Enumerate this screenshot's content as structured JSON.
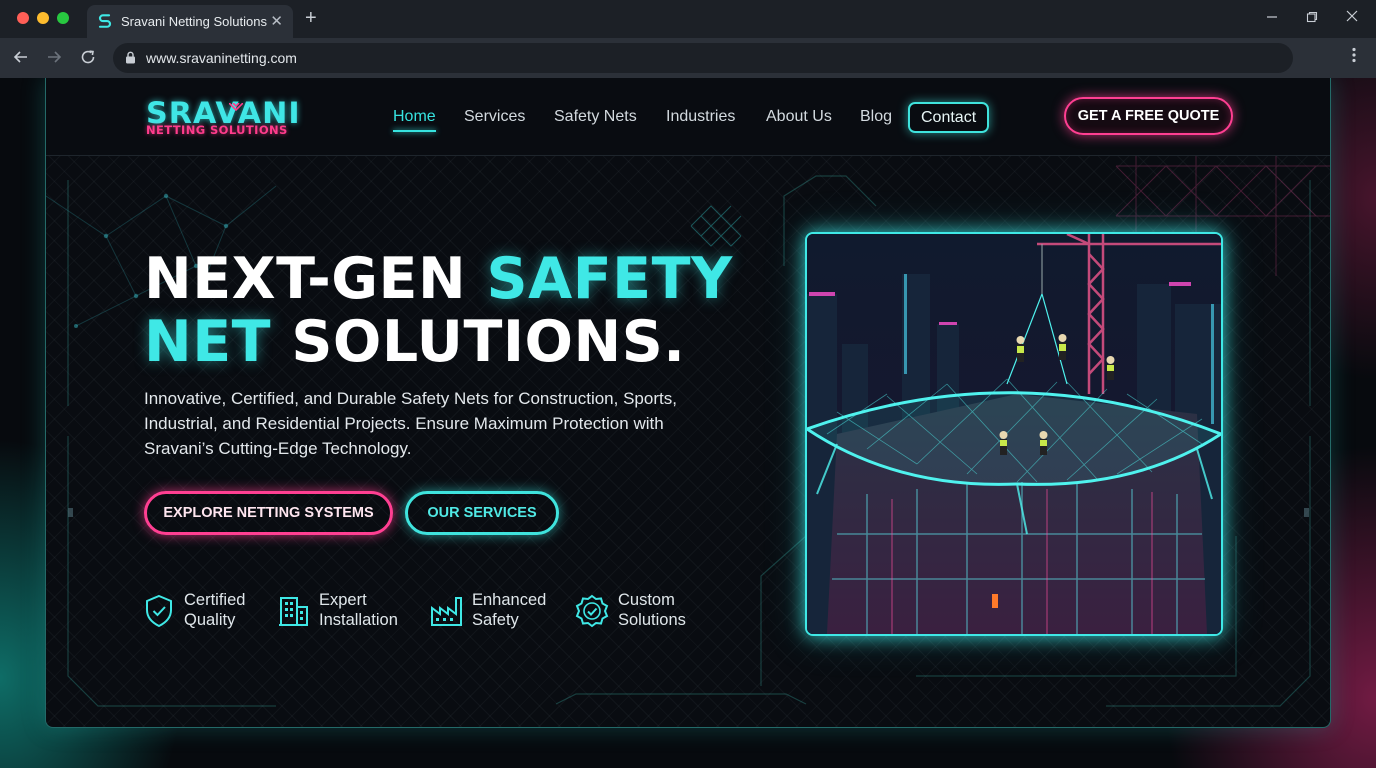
{
  "browser": {
    "tab_title": "Sravani Netting Solutions",
    "url": "www.sravaninetting.com",
    "icons": {
      "favicon": "s-logo-icon",
      "close_tab": "close-icon",
      "new_tab": "plus-icon",
      "back": "arrow-left-icon",
      "forward": "arrow-right-icon",
      "reload": "reload-icon",
      "lock": "lock-icon",
      "menu": "kebab-menu-icon",
      "minimize": "minimize-icon",
      "maximize": "restore-icon",
      "close_window": "close-icon"
    }
  },
  "site": {
    "logo": {
      "main": "SRAVANI",
      "sub": "NETTING SOLUTIONS"
    },
    "nav": {
      "items": [
        {
          "label": "Home",
          "active": true
        },
        {
          "label": "Services"
        },
        {
          "label": "Safety Nets"
        },
        {
          "label": "Industries"
        },
        {
          "label": "About Us"
        },
        {
          "label": "Blog"
        },
        {
          "label": "Contact",
          "outlined": true
        }
      ]
    },
    "quote_button": "GET A FREE QUOTE",
    "hero": {
      "title_part1": "NEXT-GEN ",
      "title_part2": "SAFETY",
      "title_part3": "NET",
      "title_part4": " SOLUTIONS.",
      "description": "Innovative, Certified, and Durable Safety Nets for Construction, Sports, Industrial, and Residential Projects. Ensure Maximum Protection with Sravani’s Cutting-Edge Technology.",
      "primary_button": "EXPLORE NETTING SYSTEMS",
      "secondary_button": "OUR SERVICES",
      "image_icon": "construction-safety-net-illustration"
    },
    "features": [
      {
        "line1": "Certified",
        "line2": "Quality",
        "icon": "shield-check-icon"
      },
      {
        "line1": "Expert",
        "line2": "Installation",
        "icon": "building-icon"
      },
      {
        "line1": "Enhanced",
        "line2": "Safety",
        "icon": "factory-icon"
      },
      {
        "line1": "Custom",
        "line2": "Solutions",
        "icon": "badge-check-icon"
      }
    ]
  },
  "colors": {
    "accent_cyan": "#3fe8e6",
    "accent_pink": "#ff3f92",
    "background": "#090c11"
  }
}
